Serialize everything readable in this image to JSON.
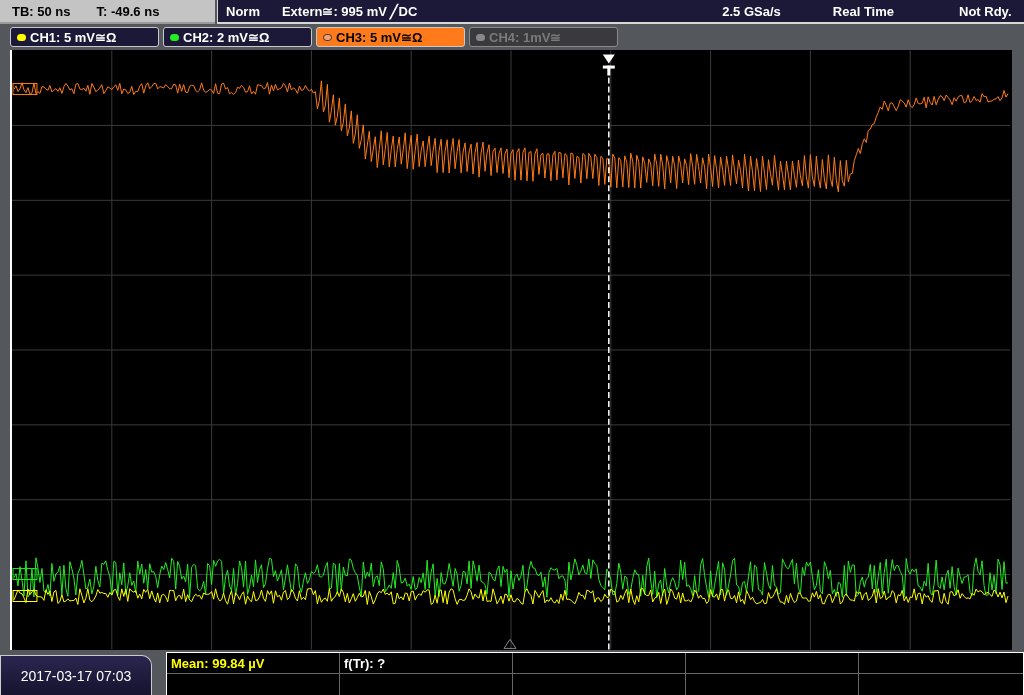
{
  "timebase": {
    "tb": "TB: 50 ns",
    "t": "T: -49.6 ns"
  },
  "status": {
    "mode": "Norm",
    "trigger": "Extern≅: 995 mV ╱DC",
    "sample_rate": "2.5 GSa/s",
    "acquisition": "Real Time",
    "state": "Not Rdy."
  },
  "channels": [
    {
      "label": "CH1: 5 mV≅Ω",
      "color": "#ffff00",
      "selected": false,
      "enabled": true
    },
    {
      "label": "CH2: 2 mV≅Ω",
      "color": "#22ee22",
      "selected": false,
      "enabled": true
    },
    {
      "label": "CH3: 5 mV≅Ω",
      "color": "#ff7a1a",
      "selected": true,
      "enabled": true
    },
    {
      "label": "CH4: 1mV≅",
      "color": "#888888",
      "selected": false,
      "enabled": false
    }
  ],
  "measurements": [
    {
      "text": "Mean: 99.84 µV",
      "color": "#ffff00"
    },
    {
      "text": "f(Tr): ?",
      "color": "#ffffff"
    }
  ],
  "date": "2017-03-17 07:03"
}
